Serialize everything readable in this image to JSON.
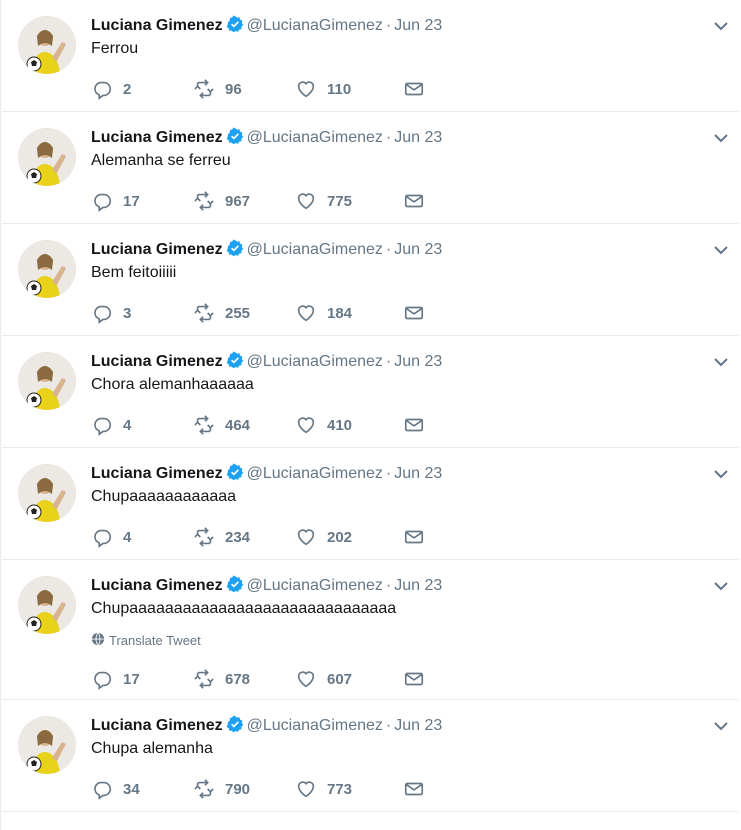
{
  "author": {
    "name": "Luciana Gimenez",
    "handle": "@LucianaGimenez",
    "verified": true
  },
  "icons": {
    "verified": "verified-badge-icon",
    "caret": "chevron-down-icon",
    "reply": "reply-icon",
    "retweet": "retweet-icon",
    "like": "heart-icon",
    "dm": "envelope-icon",
    "translate": "globe-icon"
  },
  "colors": {
    "verified_blue": "#1da1f2",
    "muted_text": "#657786",
    "divider": "#e6ecf0"
  },
  "tweets": [
    {
      "date": "Jun 23",
      "text": "Ferrou",
      "replies": "2",
      "retweets": "96",
      "likes": "110"
    },
    {
      "date": "Jun 23",
      "text": "Alemanha se ferreu",
      "replies": "17",
      "retweets": "967",
      "likes": "775"
    },
    {
      "date": "Jun 23",
      "text": "Bem feitoiiiii",
      "replies": "3",
      "retweets": "255",
      "likes": "184"
    },
    {
      "date": "Jun 23",
      "text": "Chora alemanhaaaaaa",
      "replies": "4",
      "retweets": "464",
      "likes": "410"
    },
    {
      "date": "Jun 23",
      "text": "Chupaaaaaaaaaaaa",
      "replies": "4",
      "retweets": "234",
      "likes": "202"
    },
    {
      "date": "Jun 23",
      "text": "Chupaaaaaaaaaaaaaaaaaaaaaaaaaaaaaa",
      "translate": "Translate Tweet",
      "replies": "17",
      "retweets": "678",
      "likes": "607"
    },
    {
      "date": "Jun 23",
      "text": "Chupa alemanha",
      "replies": "34",
      "retweets": "790",
      "likes": "773"
    }
  ]
}
